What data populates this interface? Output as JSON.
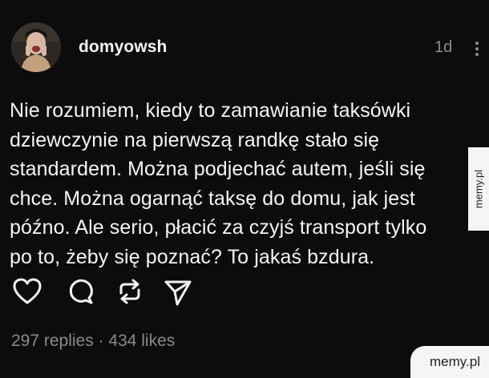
{
  "post": {
    "username": "domyowsh",
    "time": "1d",
    "text": "Nie rozumiem, kiedy to zamawianie taksówki\ndziewczynie na pierwszą randkę stało się\nstandardem. Można podjechać autem, jeśli się\nchce. Można ogarnąć taksę do domu, jak jest\npóźno. Ale serio, płacić za czyjś transport tylko\npo to, żeby się poznać? To jakaś bzdura.",
    "stats": "297 replies · 434 likes"
  },
  "actions": [
    {
      "icon": "heart-icon"
    },
    {
      "icon": "comment-icon"
    },
    {
      "icon": "repost-icon"
    },
    {
      "icon": "share-icon"
    }
  ],
  "watermarks": {
    "side": "memy.pl",
    "corner": "memy.pl"
  },
  "colors": {
    "background": "#0c0c0c",
    "text": "#f4f4f4",
    "muted": "#8c8c8c",
    "watermark_bg": "#f5f5f5"
  }
}
